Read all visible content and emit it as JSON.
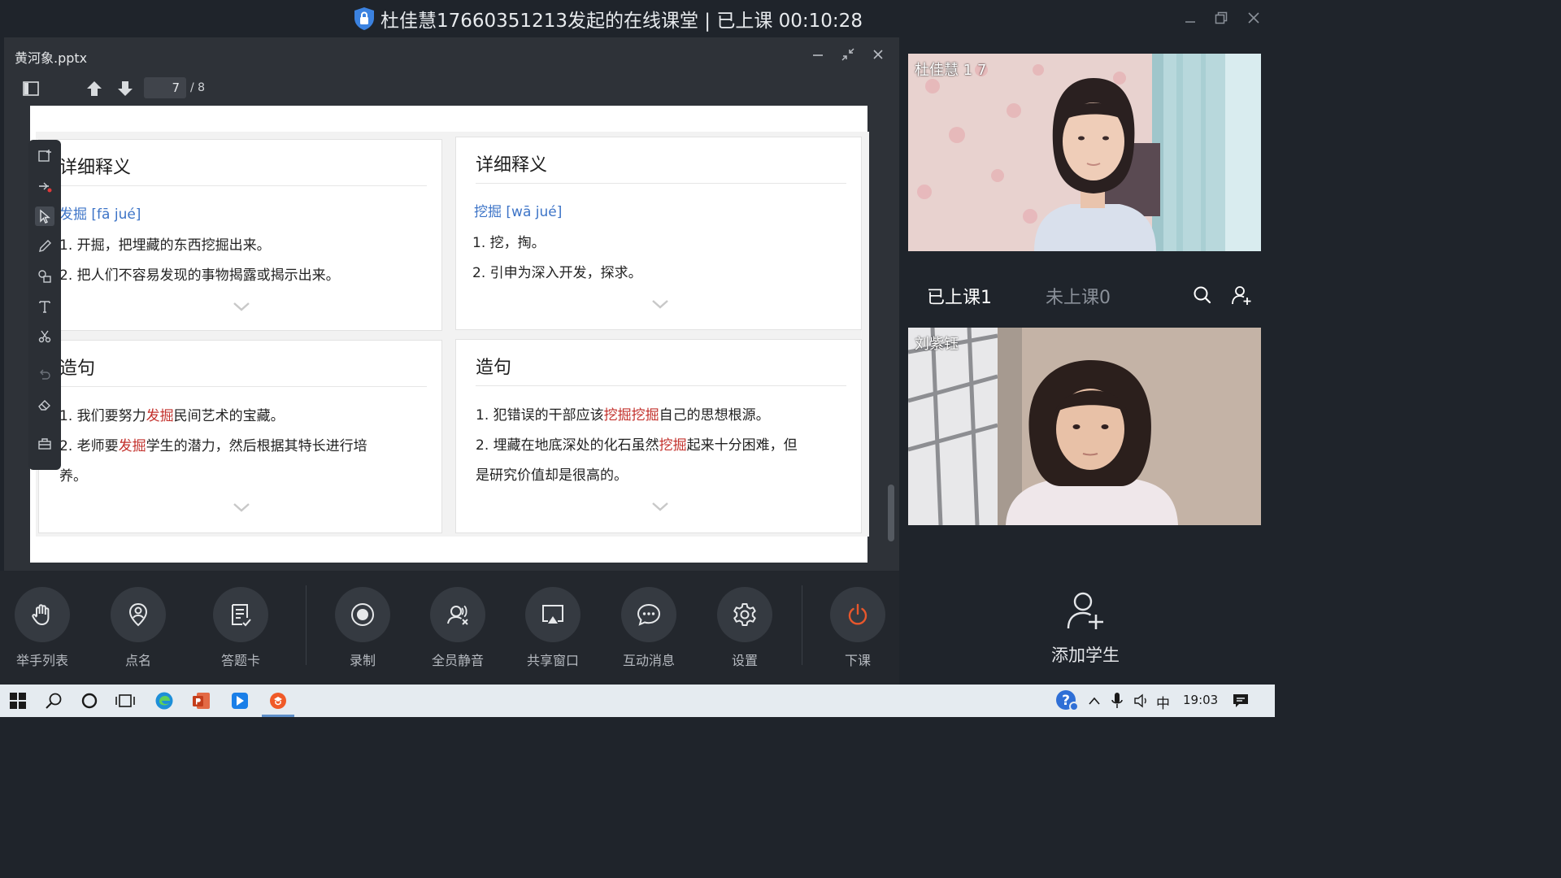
{
  "window": {
    "title": "杜佳慧17660351213发起的在线课堂 | 已上课 00:10:28"
  },
  "presenter": {
    "file_name": "黄河象.pptx",
    "page_current": "7",
    "page_total": "/ 8"
  },
  "slide": {
    "cards": [
      {
        "title": "详细释义",
        "pinyin": "发掘 [fā jué]",
        "lines": [
          "1. 开掘，把埋藏的东西挖掘出来。",
          "2. 把人们不容易发现的事物揭露或揭示出来。"
        ]
      },
      {
        "title": "详细释义",
        "pinyin": "挖掘 [wā jué]",
        "lines": [
          "1. 挖，掏。",
          "2. 引申为深入开发，探求。"
        ]
      },
      {
        "title": "造句",
        "lines": [
          {
            "before": "1. 我们要努力",
            "highlight": "发掘",
            "after": "民间艺术的宝藏。"
          },
          {
            "before": "2. 老师要",
            "highlight": "发掘",
            "after": "学生的潜力，然后根据其特长进行培"
          },
          {
            "before": "养。",
            "highlight": "",
            "after": ""
          }
        ]
      },
      {
        "title": "造句",
        "lines": [
          {
            "before": "1. 犯错误的干部应该",
            "highlight": "挖掘挖掘",
            "after": "自己的思想根源。"
          },
          {
            "before": "2. 埋藏在地底深处的化石虽然",
            "highlight": "挖掘",
            "after": "起来十分困难，但"
          },
          {
            "before": "是研究价值却是很高的。",
            "highlight": "",
            "after": ""
          }
        ]
      }
    ]
  },
  "bottom_toolbar": [
    {
      "label": "举手列表",
      "icon": "raise-hand-icon"
    },
    {
      "label": "点名",
      "icon": "roll-call-icon"
    },
    {
      "label": "答题卡",
      "icon": "answer-card-icon"
    },
    {
      "label": "录制",
      "icon": "record-icon"
    },
    {
      "label": "全员静音",
      "icon": "mute-all-icon"
    },
    {
      "label": "共享窗口",
      "icon": "share-window-icon"
    },
    {
      "label": "互动消息",
      "icon": "chat-icon"
    },
    {
      "label": "设置",
      "icon": "settings-icon"
    },
    {
      "label": "下课",
      "icon": "power-icon"
    }
  ],
  "participants": {
    "video1_name": "杜佳慧 1 7",
    "video2_name": "刘紫钰",
    "tab_joined": "已上课1",
    "tab_not_joined": "未上课0",
    "add_student": "添加学生"
  },
  "taskbar": {
    "ime": "中",
    "time": "19:03"
  },
  "colors": {
    "accent_power": "#e8572c",
    "pinyin_blue": "#3d74c7",
    "highlight_red": "#c3312c"
  }
}
